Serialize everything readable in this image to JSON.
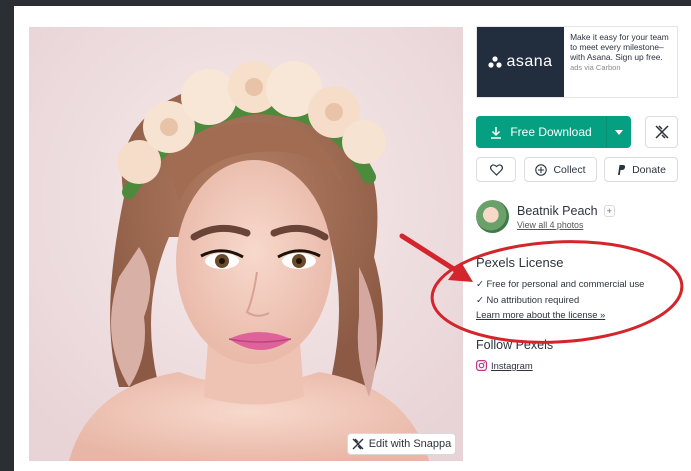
{
  "ad": {
    "brand": "asana",
    "text": "Make it easy for your team to meet every milestone–with Asana. Sign up free.",
    "via": "ads via Carbon"
  },
  "download": {
    "label": "Free Download"
  },
  "actions": {
    "collect": "Collect",
    "donate": "Donate"
  },
  "author": {
    "name": "Beatnik Peach",
    "sub": "View all 4 photos",
    "badge": "+"
  },
  "license": {
    "title": "Pexels License",
    "item1": "✓ Free for personal and commercial use",
    "item2": "✓ No attribution required",
    "link": "Learn more about the license »"
  },
  "follow": {
    "title": "Follow Pexels",
    "instagram": "Instagram"
  },
  "photo": {
    "edit_label": "Edit with Snappa"
  },
  "colors": {
    "download_green": "#05a081",
    "annotation_red": "#d3252b",
    "ad_dark": "#222e3e"
  }
}
